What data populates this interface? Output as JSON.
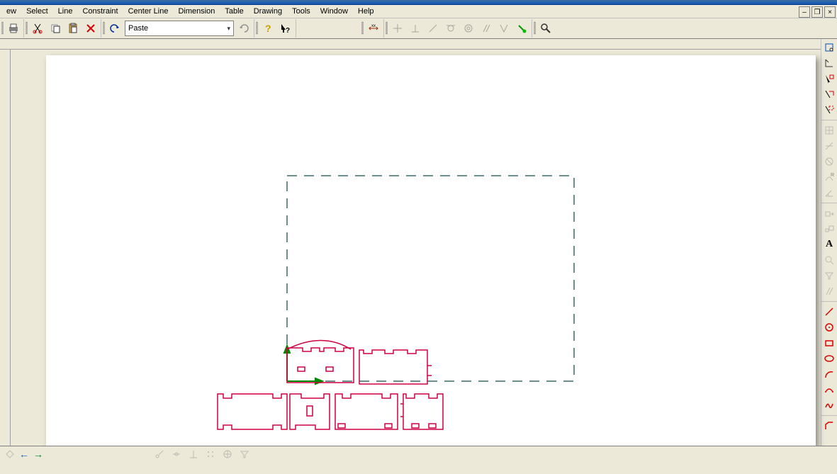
{
  "menu": {
    "items": [
      "ew",
      "Select",
      "Line",
      "Constraint",
      "Center Line",
      "Dimension",
      "Table",
      "Drawing",
      "Tools",
      "Window",
      "Help"
    ]
  },
  "toolbar": {
    "combo_value": "Paste"
  },
  "rightTools": [
    "select-items",
    "trap-pick",
    "select-element",
    "select-chain",
    "select-feature",
    "sep",
    "grid-toggle",
    "axes-toggle",
    "circle-measure",
    "radius-dim",
    "angle-dim",
    "sep",
    "move-to",
    "scale-to",
    "text-annotation",
    "zoom-area",
    "filter",
    "parallel",
    "sep",
    "line",
    "circle",
    "rectangle",
    "ellipse",
    "arc-center",
    "arc-3pt",
    "spline",
    "sep",
    "chamfer"
  ],
  "statusTools": [
    "snap-end",
    "snap-mid",
    "snap-perp",
    "snap-grid",
    "snap-center",
    "filter"
  ],
  "nav": {
    "prev": "←",
    "next": "→"
  },
  "textA": "A"
}
